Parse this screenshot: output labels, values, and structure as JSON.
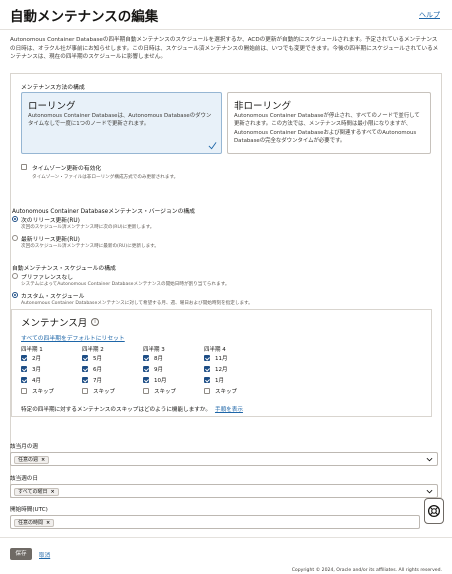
{
  "header": {
    "title": "自動メンテナンスの編集",
    "help_label": "ヘルプ"
  },
  "intro": "Autonomous Container Databaseの四半期自動メンテナンスのスケジュールを選択するか、ACDの更新が自動的にスケジュールされます。予定されているメンテナンスの日時は、オラクル社が事前にお知らせします。この日時は、スケジュール済メンテナンスの開始前は、いつでも変更できます。今後の四半期にスケジュールされているメンテナンスは、現在の四半期のスケジュールに影響しません。",
  "method": {
    "label": "メンテナンス方法の構成",
    "rolling": {
      "title": "ローリング",
      "desc": "Autonomous Container Databaseは、Autonomous Databaseのダウンタイムなしで一度に1つのノードで更新されます。"
    },
    "nonrolling": {
      "title": "非ローリング",
      "desc": "Autonomous Container Databaseが停止され、すべてのノードで並行して更新されます。この方法では、メンテナンス時間は最小限になりますが、Autonomous Container Databaseおよび関連するすべてのAutonomous Databaseの完全なダウンタイムが必要です。"
    },
    "timezone_label": "タイムゾーン更新の有効化",
    "timezone_hint": "タイムゾーン・ファイルは非ローリング構成方式でのみ更新されます。"
  },
  "version": {
    "label": "Autonomous Container Databaseメンテナンス・バージョンの構成",
    "next_label": "次のリリース更新(RU)",
    "next_hint": "次回のスケジュール済メンテナンス時に次の(RU)に更新します。",
    "latest_label": "最新リリース更新(RU)",
    "latest_hint": "次回のスケジュール済メンテナンス時に最新の(RU)に更新します。"
  },
  "schedule_config": {
    "label": "自動メンテナンス・スケジュールの構成",
    "nopref_label": "プリファレンスなし",
    "nopref_hint": "システムによってAutonomous Container Databaseメンテナンスの開始日時が割り当てられます。",
    "custom_label": "カスタム・スケジュール",
    "custom_hint": "Autonomous Container Databaseメンテナンスに対して希望する月、週、曜日および開始時刻を指定します。"
  },
  "schedule": {
    "title": "メンテナンス月",
    "info_icon": "i",
    "reset_label": "すべての四半期をデフォルトにリセット",
    "quarters": [
      {
        "head": "四半期 1",
        "months": [
          {
            "label": "2月",
            "checked": true
          },
          {
            "label": "3月",
            "checked": true
          },
          {
            "label": "4月",
            "checked": true
          },
          {
            "label": "スキップ",
            "checked": false
          }
        ]
      },
      {
        "head": "四半期 2",
        "months": [
          {
            "label": "5月",
            "checked": true
          },
          {
            "label": "6月",
            "checked": true
          },
          {
            "label": "7月",
            "checked": true
          },
          {
            "label": "スキップ",
            "checked": false
          }
        ]
      },
      {
        "head": "四半期 3",
        "months": [
          {
            "label": "8月",
            "checked": true
          },
          {
            "label": "9月",
            "checked": true
          },
          {
            "label": "10月",
            "checked": true
          },
          {
            "label": "スキップ",
            "checked": false
          }
        ]
      },
      {
        "head": "四半期 4",
        "months": [
          {
            "label": "11月",
            "checked": true
          },
          {
            "label": "12月",
            "checked": true
          },
          {
            "label": "1月",
            "checked": true
          },
          {
            "label": "スキップ",
            "checked": false
          }
        ]
      }
    ],
    "skip_question": "特定の四半期に対するメンテナンスのスキップはどのように機能しますか。",
    "skip_link": "手順を表示"
  },
  "fields": {
    "week_label": "該当月の週",
    "week_chip": "任意の週",
    "day_label": "該当週の日",
    "day_chip": "すべての曜日",
    "time_label": "開始時間(UTC)",
    "time_chip": "任意の時間",
    "chip_remove": "×"
  },
  "footer": {
    "save_label": "保存",
    "cancel_label": "取消",
    "copyright": "Copyright © 2024, Oracle and/or its affiliates. All rights reserved."
  },
  "colors": {
    "accent": "#1e4e86",
    "link": "#1e66a8",
    "selected_bg": "#e8f1f9",
    "save_button": "#6f6a65"
  }
}
